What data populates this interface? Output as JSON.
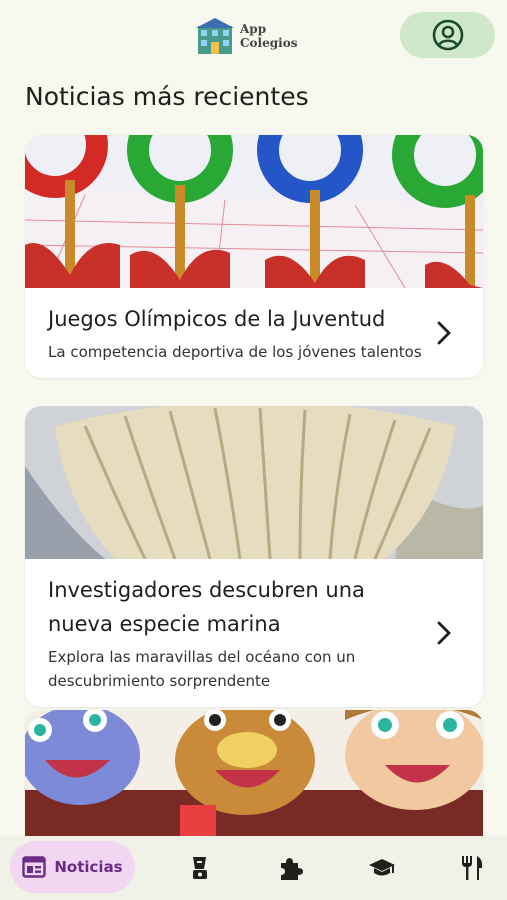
{
  "header": {
    "logo_line1": "App",
    "logo_line2": "Colegios"
  },
  "section": {
    "title": "Noticias más recientes"
  },
  "news": [
    {
      "title": "Juegos Olímpicos de la Juventud",
      "subtitle": "La competencia deportiva de los jóvenes talentos",
      "image": "olympic-rings-illustration"
    },
    {
      "title": "Investigadores descubren una nueva especie marina",
      "subtitle": "Explora las maravillas del océano con un descubrimiento sorprendente",
      "image": "seashell-photo"
    },
    {
      "title": "",
      "subtitle": "",
      "image": "cartoon-characters-illustration"
    }
  ],
  "nav": {
    "active_label": "Noticias",
    "items": [
      "news-icon",
      "blender-icon",
      "puzzle-icon",
      "graduation-cap-icon",
      "fork-knife-icon"
    ]
  },
  "colors": {
    "background": "#f7f8ee",
    "account_button": "#cfe8cb",
    "nav_active": "#f1d7f1",
    "nav_active_text": "#6a2c87"
  }
}
